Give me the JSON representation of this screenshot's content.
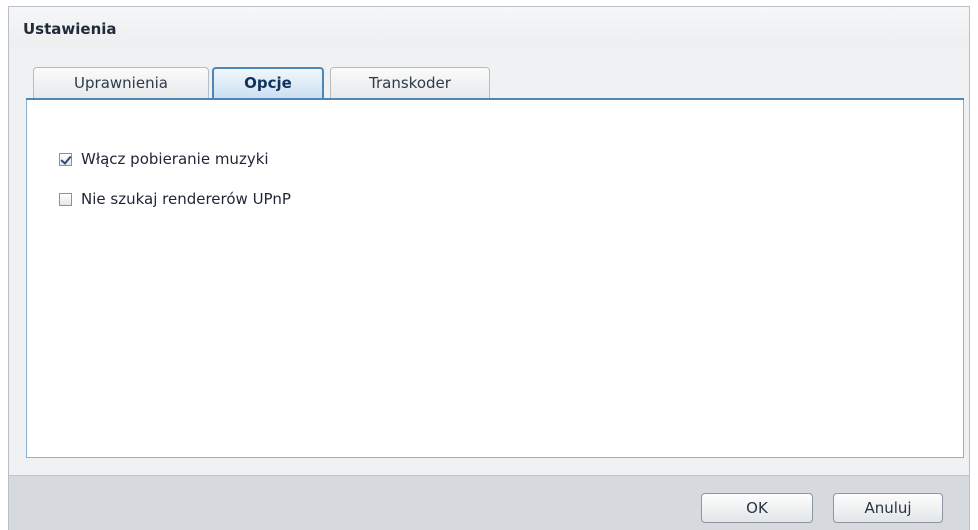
{
  "dialog": {
    "title": "Ustawienia"
  },
  "tabs": [
    {
      "label": "Uprawnienia",
      "active": false
    },
    {
      "label": "Opcje",
      "active": true
    },
    {
      "label": "Transkoder",
      "active": false
    }
  ],
  "options": [
    {
      "label": "Włącz pobieranie muzyki",
      "checked": true
    },
    {
      "label": "Nie szukaj rendererów UPnP",
      "checked": false
    }
  ],
  "footer": {
    "ok_label": "OK",
    "cancel_label": "Anuluj"
  },
  "colors": {
    "accent": "#4e86b8",
    "footer_bg": "#d6d9dd"
  }
}
